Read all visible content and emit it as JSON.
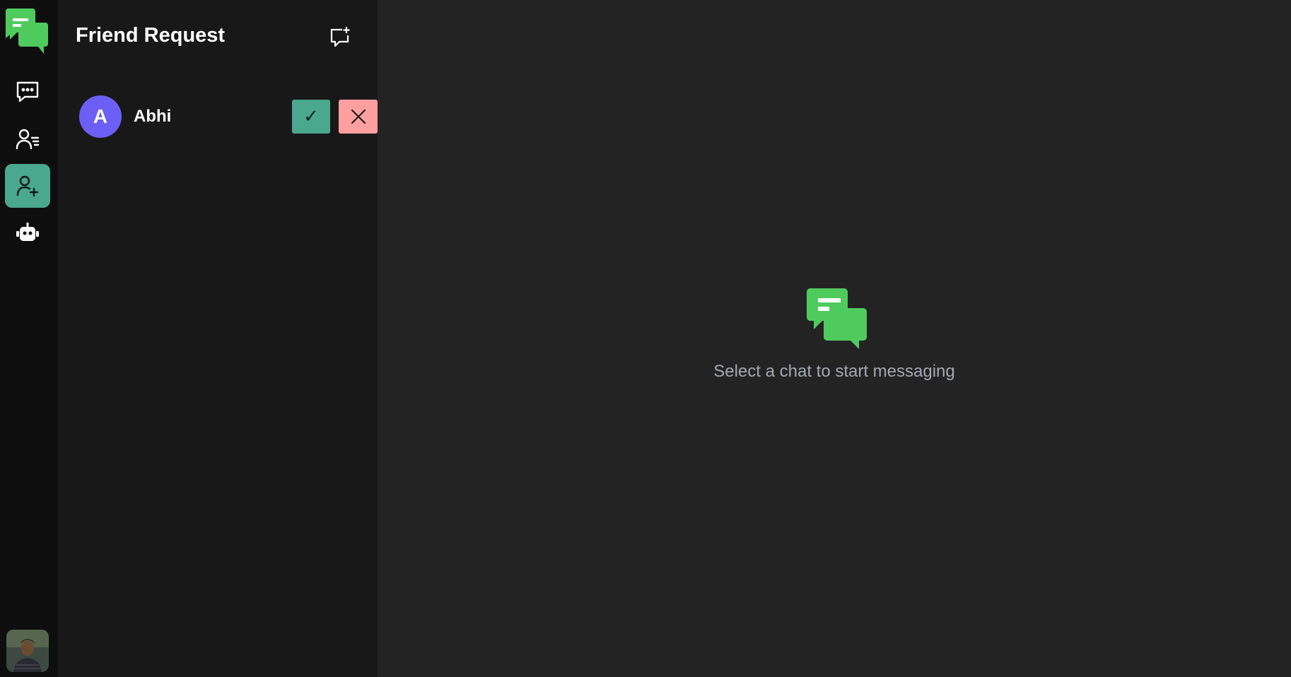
{
  "rail": {
    "logo_icon": "chat-bubbles-logo",
    "items": [
      {
        "name": "chats",
        "icon": "chat-dots-icon",
        "active": false
      },
      {
        "name": "contacts",
        "icon": "contacts-list-icon",
        "active": false
      },
      {
        "name": "friend-requests",
        "icon": "add-user-icon",
        "active": true
      },
      {
        "name": "bot",
        "icon": "robot-icon",
        "active": false
      }
    ],
    "accent_color": "#4aa88f"
  },
  "panel": {
    "title": "Friend Request",
    "requests": [
      {
        "initial": "A",
        "name": "Abhi",
        "avatar_color": "#6c5ff5"
      }
    ],
    "accept_glyph": "✓",
    "accept_color": "#4aa88f",
    "reject_color": "#ff9f9f"
  },
  "main": {
    "empty_text": "Select a chat to start messaging",
    "logo_color": "#4fcb5e"
  }
}
